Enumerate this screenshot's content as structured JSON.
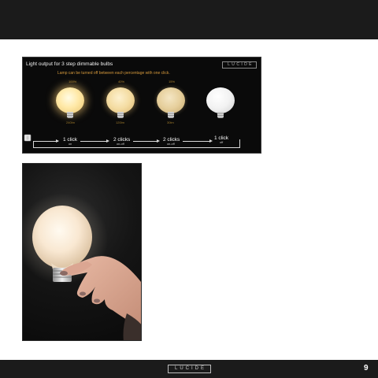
{
  "brand": "LUCIDE",
  "page_number": "9",
  "banner": {
    "title": "Light output for 3 step dimmable bulbs",
    "subtitle": "Lamp can be turned off between each percentage with one click.",
    "steps": [
      {
        "percent": "100%",
        "lumen": "240lm",
        "click": "1 click",
        "action": "on"
      },
      {
        "percent": "40%",
        "lumen": "120lm",
        "click": "2 clicks",
        "action": "on-off"
      },
      {
        "percent": "15%",
        "lumen": "30lm",
        "click": "2 clicks",
        "action": "on-off"
      },
      {
        "percent": "",
        "lumen": "",
        "click": "1 click",
        "action": "off"
      }
    ]
  },
  "colors": {
    "bar": "#1b1b1b",
    "accent_orange": "#d79a3c",
    "bulb_100": "#ffe9a8",
    "bulb_40": "#f4dca2",
    "bulb_15": "#e6cf9c",
    "bulb_off": "#f2f2f2"
  }
}
